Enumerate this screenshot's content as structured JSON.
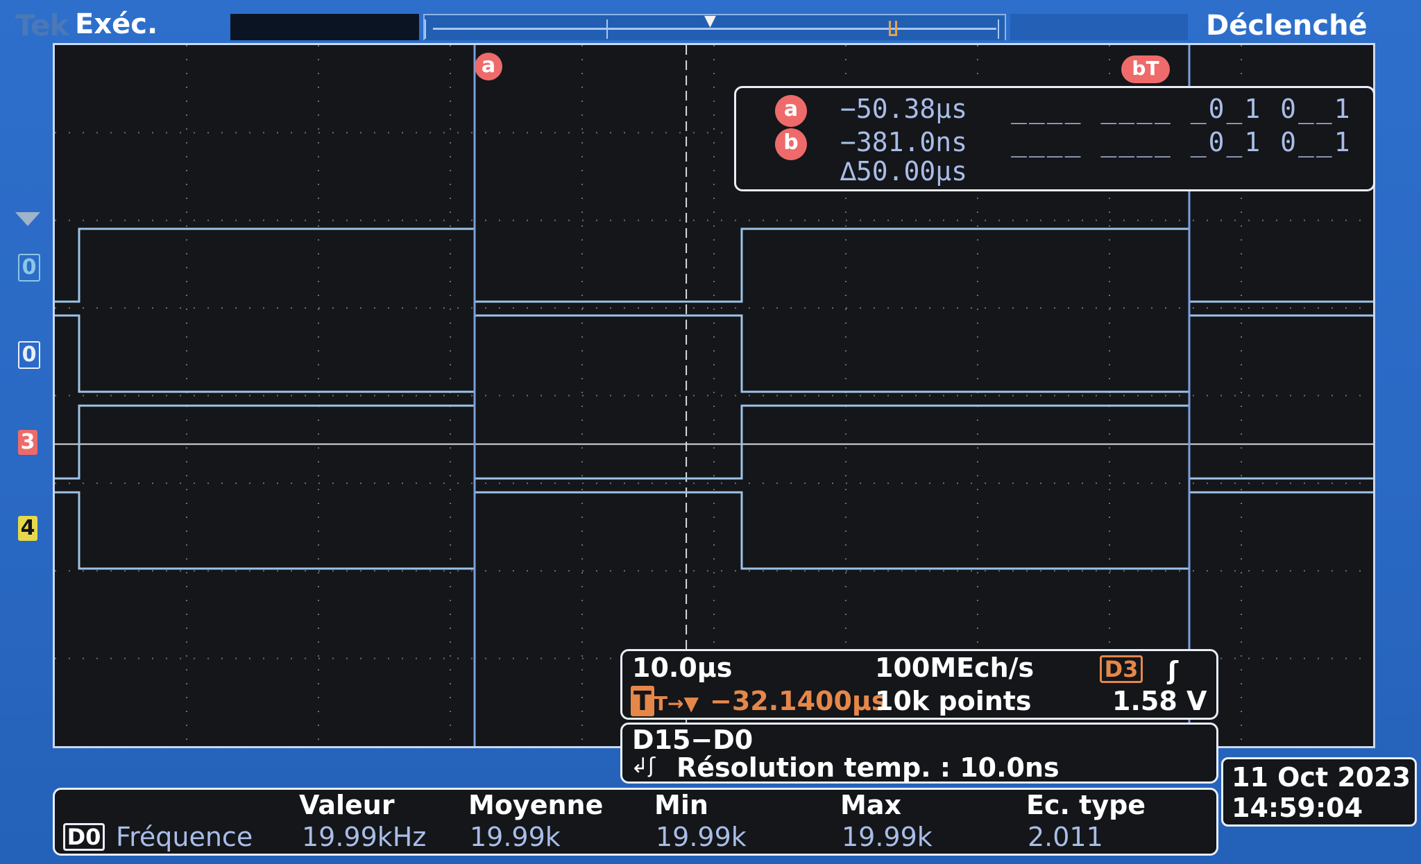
{
  "header": {
    "brand": "Tek",
    "run_state": "Exéc.",
    "trigger_status": "Déclenché"
  },
  "channels": [
    {
      "label": "0",
      "color": "#8ec6e6"
    },
    {
      "label": "0",
      "color": "#e9eef8"
    },
    {
      "label": "3",
      "color": "#ef6a6a"
    },
    {
      "label": "4",
      "color": "#e6d84a"
    }
  ],
  "cursors": {
    "a_label": "a",
    "b_label": "b",
    "bt_label": "bT",
    "a_time": "−50.38µs",
    "b_time": "−381.0ns",
    "delta": "∆50.00µs",
    "a_bits": "____ ____ _0_1 0__1",
    "b_bits": "____ ____ _0_1 0__1"
  },
  "timebase": {
    "scale": "10.0µs",
    "sample_rate": "100MEch/s",
    "trigger_source": "D3",
    "trigger_position_prefix": "T→▼",
    "trigger_position": "−32.1400µs",
    "record_length": "10k points",
    "trigger_level": "1.58 V"
  },
  "bus": {
    "name": "D15−D0",
    "resolution": "Résolution temp.  : 10.0ns"
  },
  "datetime": {
    "date": "11 Oct  2023",
    "time": "14:59:04"
  },
  "measurements": {
    "source": "D0",
    "name": "Fréquence",
    "headers": [
      "Valeur",
      "Moyenne",
      "Min",
      "Max",
      "Ec. type"
    ],
    "values": [
      "19.99kHz",
      "19.99k",
      "19.99k",
      "19.99k",
      "2.011"
    ]
  },
  "colors": {
    "screen_bg": "#2a69c4",
    "graticule_bg": "#141619",
    "trace_a": "#9ec3e8",
    "trace_b": "#b3dcc2",
    "cursor_color": "#ef6a6a",
    "readout_text": "#a9bde8",
    "trigger_accent": "#e6874a"
  }
}
